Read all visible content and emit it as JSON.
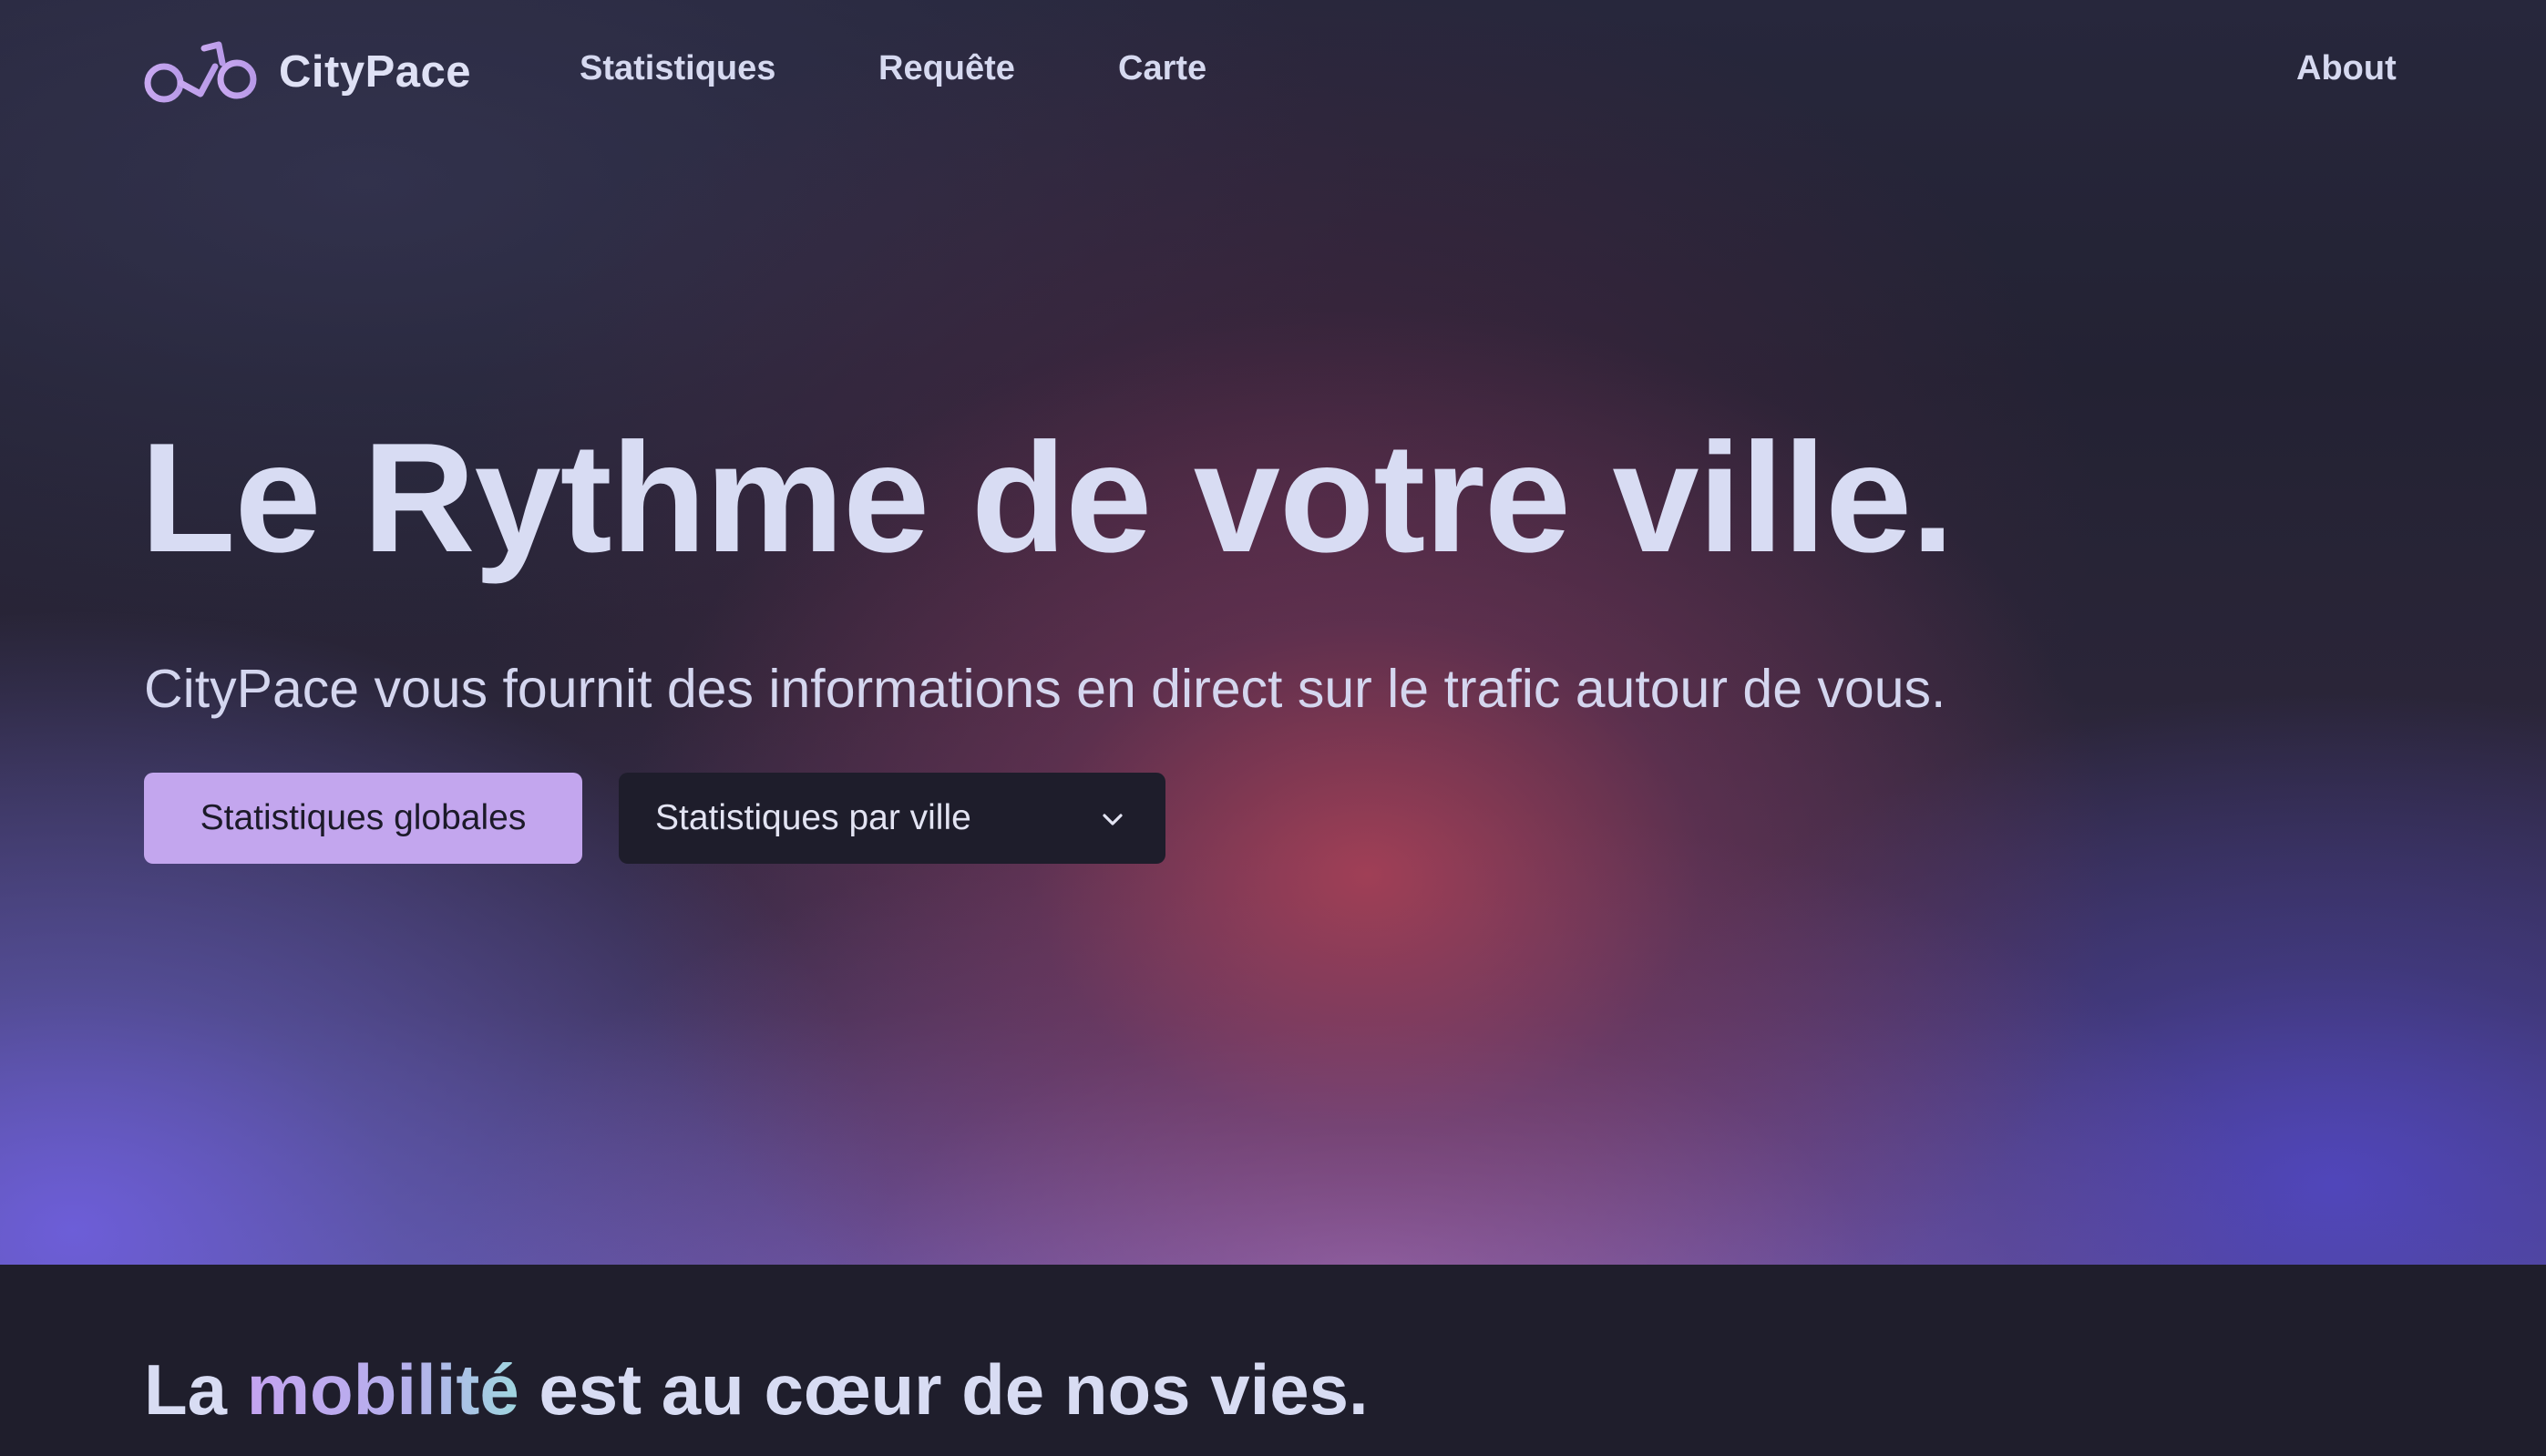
{
  "brand": {
    "name": "CityPace",
    "logo_icon": "bicycle-icon"
  },
  "nav": {
    "links": [
      "Statistiques",
      "Requête",
      "Carte"
    ],
    "about": "About"
  },
  "hero": {
    "title": "Le Rythme de votre ville.",
    "subtitle": "CityPace vous fournit des informations en direct sur le trafic autour de vous.",
    "primary_button": "Statistiques globales",
    "select_button": "Statistiques par ville",
    "select_icon": "chevron-down-icon"
  },
  "section": {
    "title_before": "La ",
    "title_accent": "mobilité",
    "title_after": " est au cœur de nos vies."
  },
  "colors": {
    "accent": "#c3a6ee",
    "text": "#d8dcf3",
    "dark": "#1f1e2c"
  }
}
